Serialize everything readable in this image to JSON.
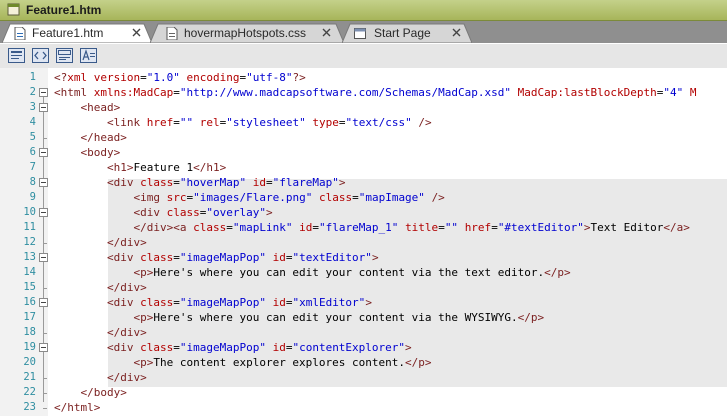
{
  "window": {
    "title": "Feature1.htm"
  },
  "tabs": [
    {
      "label": "Feature1.htm",
      "active": true
    },
    {
      "label": "hovermapHotspots.css",
      "active": false
    },
    {
      "label": "Start Page",
      "active": false
    }
  ],
  "toolbar": {
    "buttons": [
      {
        "icon": "view-toggle-icon"
      },
      {
        "icon": "code-view-icon"
      },
      {
        "icon": "split-view-icon"
      },
      {
        "icon": "text-format-icon"
      }
    ]
  },
  "editor": {
    "line_numbers": [
      "1",
      "2",
      "3",
      "4",
      "5",
      "6",
      "7",
      "8",
      "9",
      "10",
      "11",
      "12",
      "13",
      "14",
      "15",
      "16",
      "17",
      "18",
      "19",
      "20",
      "21",
      "22",
      "23"
    ],
    "lines": [
      [
        [
          "t",
          "<?"
        ],
        [
          "a",
          "xml "
        ],
        [
          "a",
          "version"
        ],
        [
          "n",
          "="
        ],
        [
          "v",
          "\"1.0\""
        ],
        [
          "n",
          " "
        ],
        [
          "a",
          "encoding"
        ],
        [
          "n",
          "="
        ],
        [
          "v",
          "\"utf-8\""
        ],
        [
          "t",
          "?>"
        ]
      ],
      [
        [
          "t",
          "<html "
        ],
        [
          "a",
          "xmlns:MadCap"
        ],
        [
          "n",
          "="
        ],
        [
          "v",
          "\"http://www.madcapsoftware.com/Schemas/MadCap.xsd\""
        ],
        [
          "n",
          " "
        ],
        [
          "a",
          "MadCap:lastBlockDepth"
        ],
        [
          "n",
          "="
        ],
        [
          "v",
          "\"4\""
        ],
        [
          "n",
          " "
        ],
        [
          "a",
          "M"
        ]
      ],
      [
        [
          "n",
          "    "
        ],
        [
          "t",
          "<head>"
        ]
      ],
      [
        [
          "n",
          "        "
        ],
        [
          "t",
          "<link "
        ],
        [
          "a",
          "href"
        ],
        [
          "n",
          "="
        ],
        [
          "v",
          "\"\""
        ],
        [
          "n",
          " "
        ],
        [
          "a",
          "rel"
        ],
        [
          "n",
          "="
        ],
        [
          "v",
          "\"stylesheet\""
        ],
        [
          "n",
          " "
        ],
        [
          "a",
          "type"
        ],
        [
          "n",
          "="
        ],
        [
          "v",
          "\"text/css\""
        ],
        [
          "n",
          " "
        ],
        [
          "t",
          "/>"
        ]
      ],
      [
        [
          "n",
          "    "
        ],
        [
          "t",
          "</head>"
        ]
      ],
      [
        [
          "n",
          "    "
        ],
        [
          "t",
          "<body>"
        ]
      ],
      [
        [
          "n",
          "        "
        ],
        [
          "t",
          "<h1>"
        ],
        [
          "n",
          "Feature 1"
        ],
        [
          "t",
          "</h1>"
        ]
      ],
      [
        [
          "n",
          "        "
        ],
        [
          "t",
          "<div "
        ],
        [
          "a",
          "class"
        ],
        [
          "n",
          "="
        ],
        [
          "v",
          "\"hoverMap\""
        ],
        [
          "n",
          " "
        ],
        [
          "a",
          "id"
        ],
        [
          "n",
          "="
        ],
        [
          "v",
          "\"flareMap\""
        ],
        [
          "t",
          ">"
        ]
      ],
      [
        [
          "n",
          "            "
        ],
        [
          "t",
          "<img "
        ],
        [
          "a",
          "src"
        ],
        [
          "n",
          "="
        ],
        [
          "v",
          "\"images/Flare.png\""
        ],
        [
          "n",
          " "
        ],
        [
          "a",
          "class"
        ],
        [
          "n",
          "="
        ],
        [
          "v",
          "\"mapImage\""
        ],
        [
          "n",
          " "
        ],
        [
          "t",
          "/>"
        ]
      ],
      [
        [
          "n",
          "            "
        ],
        [
          "t",
          "<div "
        ],
        [
          "a",
          "class"
        ],
        [
          "n",
          "="
        ],
        [
          "v",
          "\"overlay\""
        ],
        [
          "t",
          ">"
        ]
      ],
      [
        [
          "n",
          "            "
        ],
        [
          "t",
          "</div><a "
        ],
        [
          "a",
          "class"
        ],
        [
          "n",
          "="
        ],
        [
          "v",
          "\"mapLink\""
        ],
        [
          "n",
          " "
        ],
        [
          "a",
          "id"
        ],
        [
          "n",
          "="
        ],
        [
          "v",
          "\"flareMap_1\""
        ],
        [
          "n",
          " "
        ],
        [
          "a",
          "title"
        ],
        [
          "n",
          "="
        ],
        [
          "v",
          "\"\""
        ],
        [
          "n",
          " "
        ],
        [
          "a",
          "href"
        ],
        [
          "n",
          "="
        ],
        [
          "v",
          "\"#textEditor\""
        ],
        [
          "t",
          ">"
        ],
        [
          "n",
          "Text Editor"
        ],
        [
          "t",
          "</a>"
        ]
      ],
      [
        [
          "n",
          "        "
        ],
        [
          "t",
          "</div>"
        ]
      ],
      [
        [
          "n",
          "        "
        ],
        [
          "t",
          "<div "
        ],
        [
          "a",
          "class"
        ],
        [
          "n",
          "="
        ],
        [
          "v",
          "\"imageMapPop\""
        ],
        [
          "n",
          " "
        ],
        [
          "a",
          "id"
        ],
        [
          "n",
          "="
        ],
        [
          "v",
          "\"textEditor\""
        ],
        [
          "t",
          ">"
        ]
      ],
      [
        [
          "n",
          "            "
        ],
        [
          "t",
          "<p>"
        ],
        [
          "n",
          "Here's where you can edit your content via the text editor."
        ],
        [
          "t",
          "</p>"
        ]
      ],
      [
        [
          "n",
          "        "
        ],
        [
          "t",
          "</div>"
        ]
      ],
      [
        [
          "n",
          "        "
        ],
        [
          "t",
          "<div "
        ],
        [
          "a",
          "class"
        ],
        [
          "n",
          "="
        ],
        [
          "v",
          "\"imageMapPop\""
        ],
        [
          "n",
          " "
        ],
        [
          "a",
          "id"
        ],
        [
          "n",
          "="
        ],
        [
          "v",
          "\"xmlEditor\""
        ],
        [
          "t",
          ">"
        ]
      ],
      [
        [
          "n",
          "            "
        ],
        [
          "t",
          "<p>"
        ],
        [
          "n",
          "Here's where you can edit your content via the WYSIWYG."
        ],
        [
          "t",
          "</p>"
        ]
      ],
      [
        [
          "n",
          "        "
        ],
        [
          "t",
          "</div>"
        ]
      ],
      [
        [
          "n",
          "        "
        ],
        [
          "t",
          "<div "
        ],
        [
          "a",
          "class"
        ],
        [
          "n",
          "="
        ],
        [
          "v",
          "\"imageMapPop\""
        ],
        [
          "n",
          " "
        ],
        [
          "a",
          "id"
        ],
        [
          "n",
          "="
        ],
        [
          "v",
          "\"contentExplorer\""
        ],
        [
          "t",
          ">"
        ]
      ],
      [
        [
          "n",
          "            "
        ],
        [
          "t",
          "<p>"
        ],
        [
          "n",
          "The content explorer explores content."
        ],
        [
          "t",
          "</p>"
        ]
      ],
      [
        [
          "n",
          "        "
        ],
        [
          "t",
          "</div>"
        ]
      ],
      [
        [
          "n",
          "    "
        ],
        [
          "t",
          "</body>"
        ]
      ],
      [
        [
          "t",
          "</html>"
        ]
      ]
    ],
    "fold_markers_at_lines": [
      "2",
      "3",
      "6",
      "8",
      "10",
      "13",
      "16",
      "19"
    ]
  }
}
